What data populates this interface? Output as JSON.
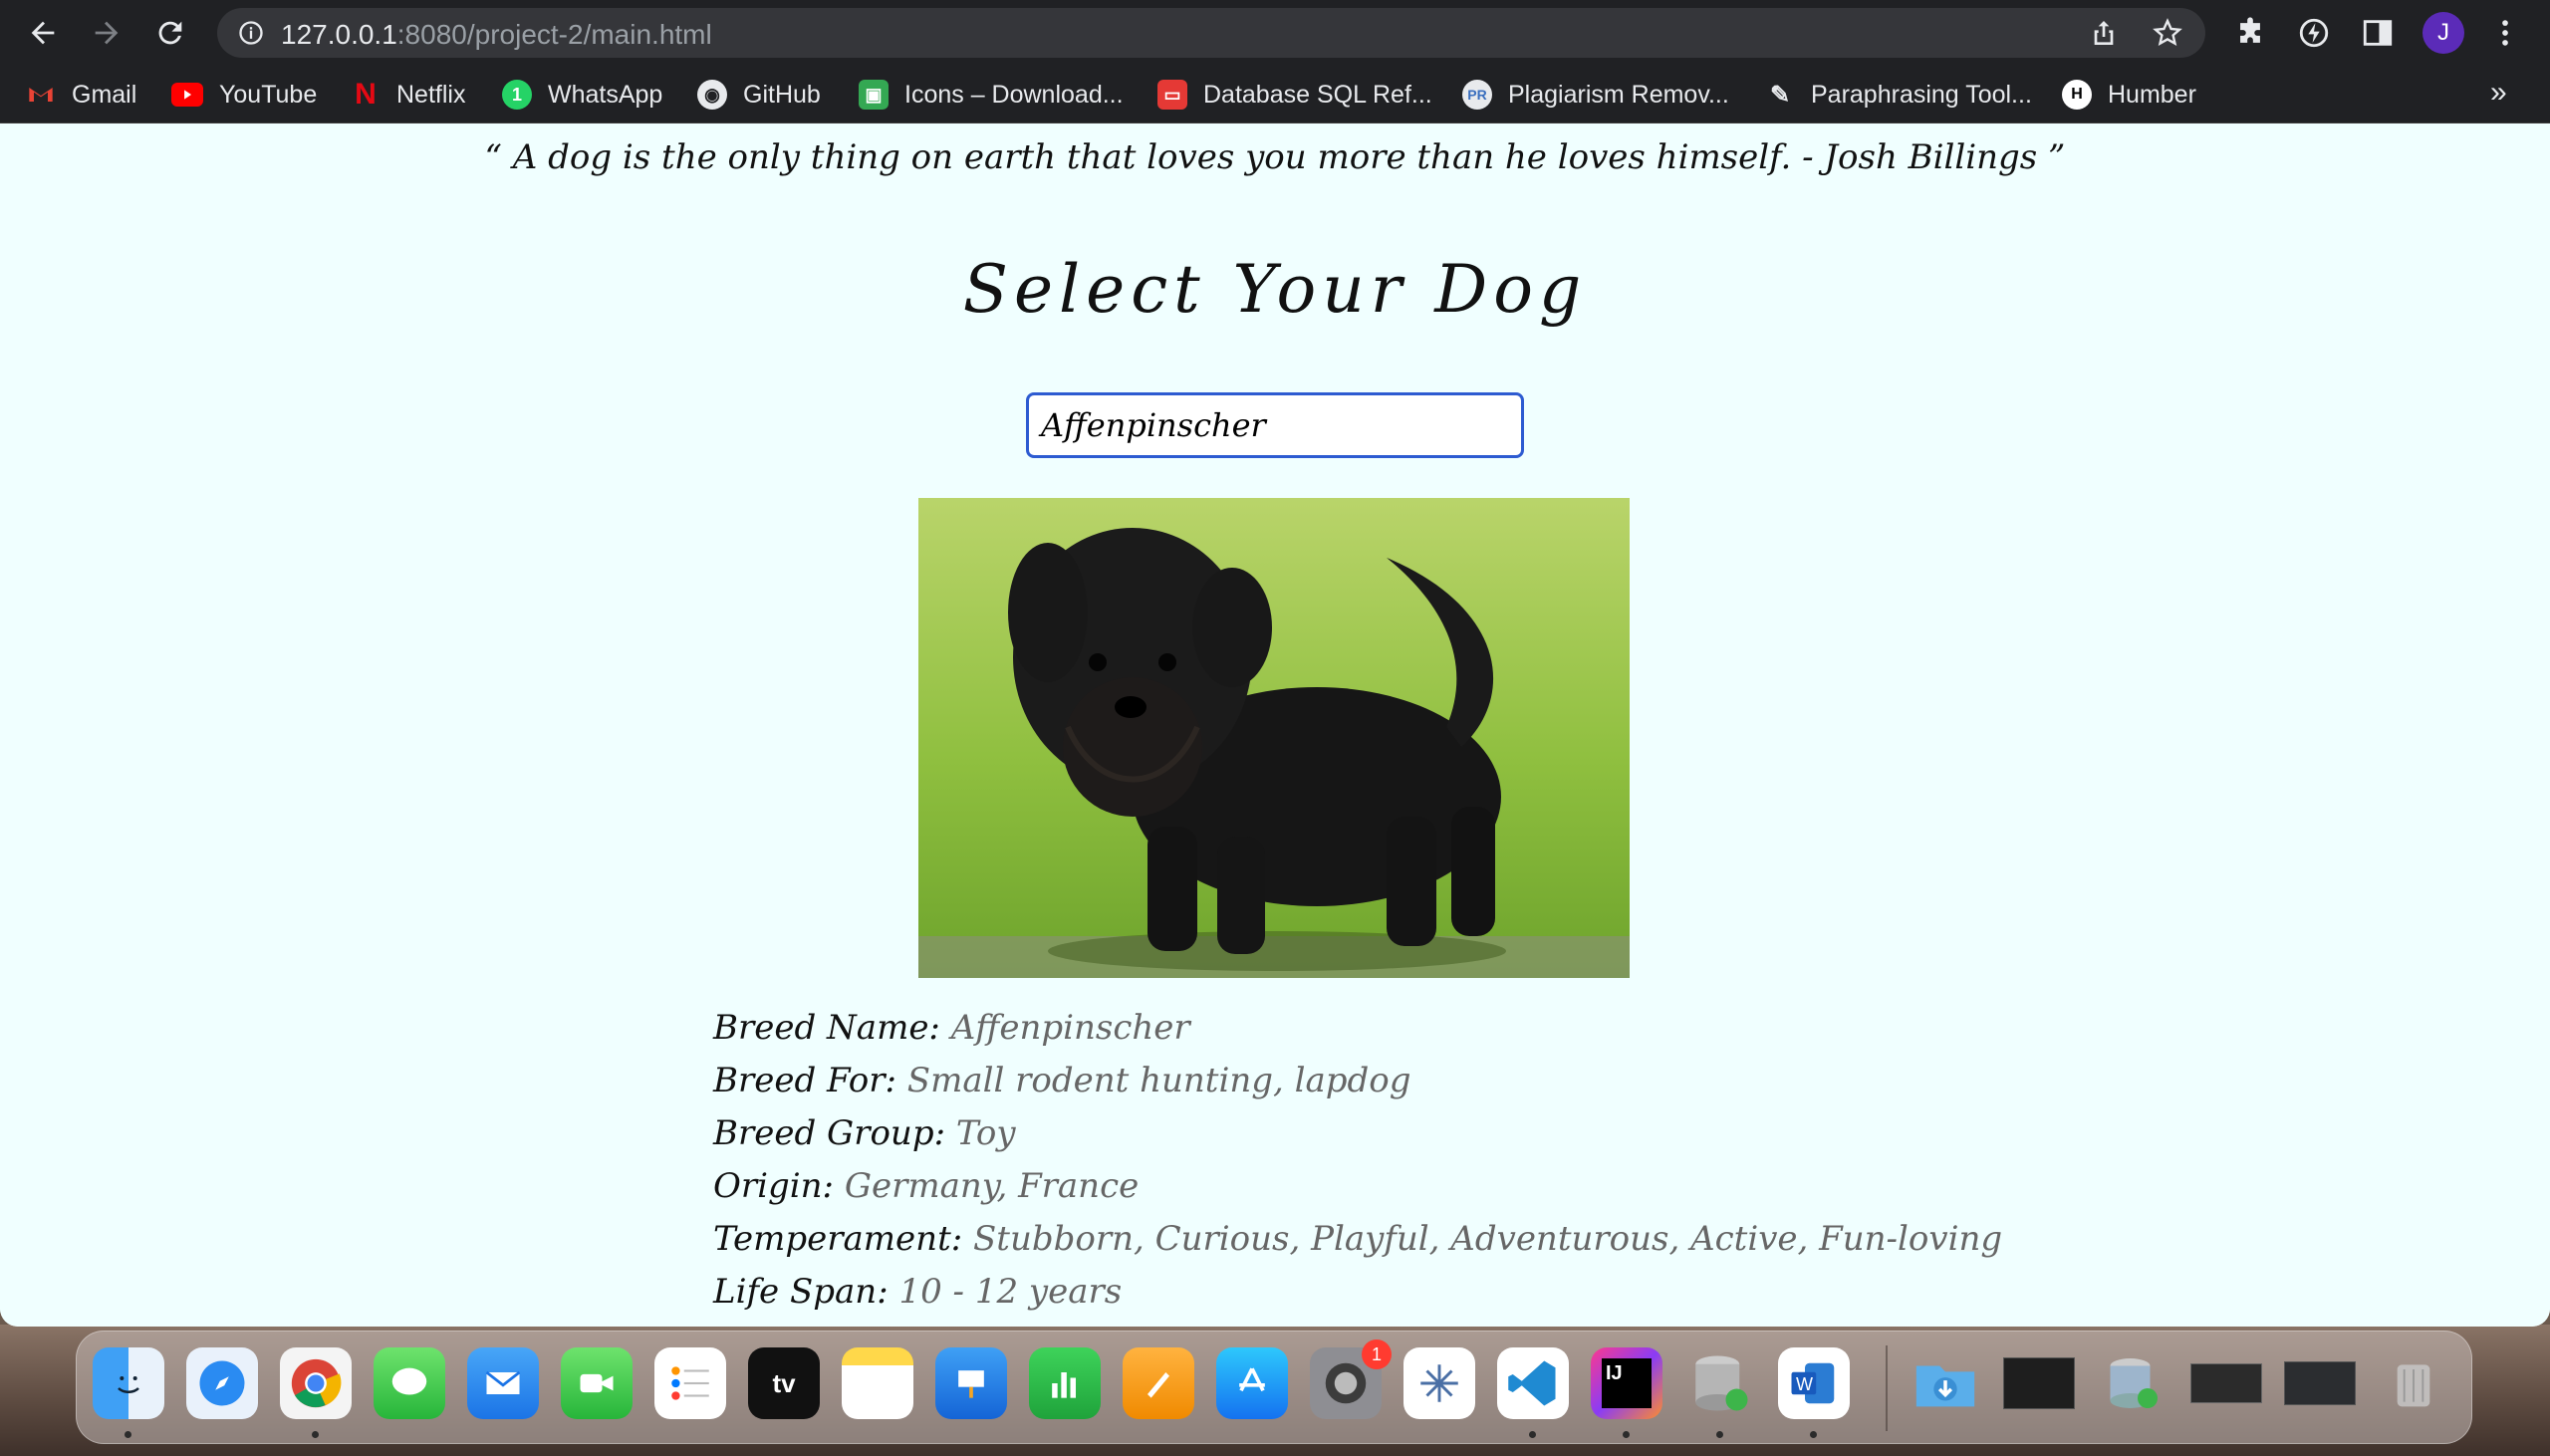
{
  "browser": {
    "url_host": "127.0.0.1",
    "url_path": ":8080/project-2/main.html",
    "profile_initial": "J",
    "bookmarks": [
      {
        "label": "Gmail",
        "icon": "gmail-icon"
      },
      {
        "label": "YouTube",
        "icon": "youtube-icon"
      },
      {
        "label": "Netflix",
        "icon": "netflix-icon"
      },
      {
        "label": "WhatsApp",
        "icon": "whatsapp-icon"
      },
      {
        "label": "GitHub",
        "icon": "github-icon"
      },
      {
        "label": "Icons – Download...",
        "icon": "icons8-icon"
      },
      {
        "label": "Database SQL Ref...",
        "icon": "oracle-icon"
      },
      {
        "label": "Plagiarism Remov...",
        "icon": "plagiarism-icon"
      },
      {
        "label": "Paraphrasing Tool...",
        "icon": "quill-icon"
      },
      {
        "label": "Humber",
        "icon": "humber-icon"
      }
    ],
    "more_bookmarks": "»"
  },
  "page": {
    "quote": "“ A dog is the only thing on earth that loves you more than he loves himself. - Josh Billings ”",
    "title": "Select Your Dog",
    "selected_breed": "Affenpinscher",
    "details": [
      {
        "label": "Breed Name:",
        "value": "Affenpinscher"
      },
      {
        "label": "Breed For:",
        "value": "Small rodent hunting, lapdog"
      },
      {
        "label": "Breed Group:",
        "value": "Toy"
      },
      {
        "label": "Origin:",
        "value": "Germany, France"
      },
      {
        "label": "Temperament:",
        "value": "Stubborn, Curious, Playful, Adventurous, Active, Fun-loving"
      },
      {
        "label": "Life Span:",
        "value": "10 - 12 years"
      }
    ]
  },
  "dock": {
    "apps": [
      "finder",
      "safari",
      "chrome",
      "messages",
      "mail",
      "facetime",
      "reminders",
      "apple-tv",
      "notes",
      "keynote",
      "numbers",
      "pages",
      "app-store",
      "system-preferences",
      "tableau",
      "vscode",
      "intellij",
      "sql-developer",
      "word",
      "downloads-folder",
      "vscode-window",
      "sql-developer-window",
      "keyboard-viewer",
      "intellij-window",
      "trash"
    ],
    "system_preferences_badge": "1"
  },
  "colors": {
    "page_bg": "#f0ffff",
    "input_border": "#2d5bd1",
    "chrome_bar": "#202124"
  }
}
